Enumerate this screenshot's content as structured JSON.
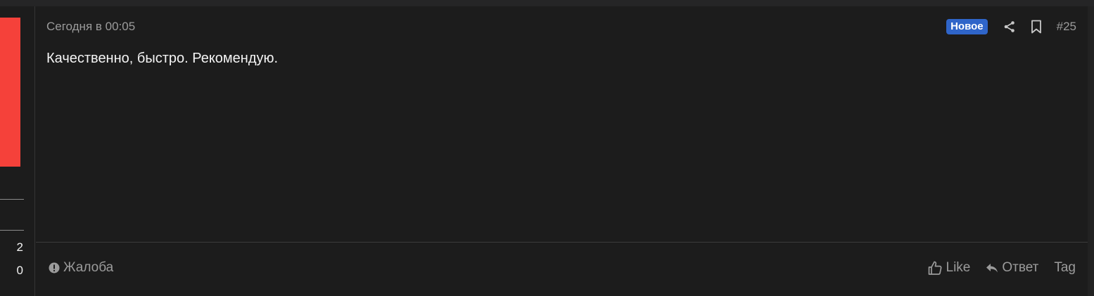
{
  "post": {
    "timestamp": "Сегодня в 00:05",
    "badge": "Новое",
    "number": "#25",
    "message": "Качественно, быстро. Рекомендую."
  },
  "author_panel": {
    "stats": [
      "2",
      "0"
    ]
  },
  "footer": {
    "report_label": "Жалоба",
    "like_label": "Like",
    "reply_label": "Ответ",
    "tag_label": "Tag"
  },
  "icons": {
    "share": "share-icon",
    "bookmark": "bookmark-icon",
    "report": "exclamation-circle-icon",
    "like": "thumbs-up-icon",
    "reply": "reply-icon"
  },
  "colors": {
    "background": "#1c1c1c",
    "avatar": "#f5413a",
    "badge": "#2f65c9",
    "muted_text": "#9b9b9b",
    "text": "#f4f4f4"
  }
}
